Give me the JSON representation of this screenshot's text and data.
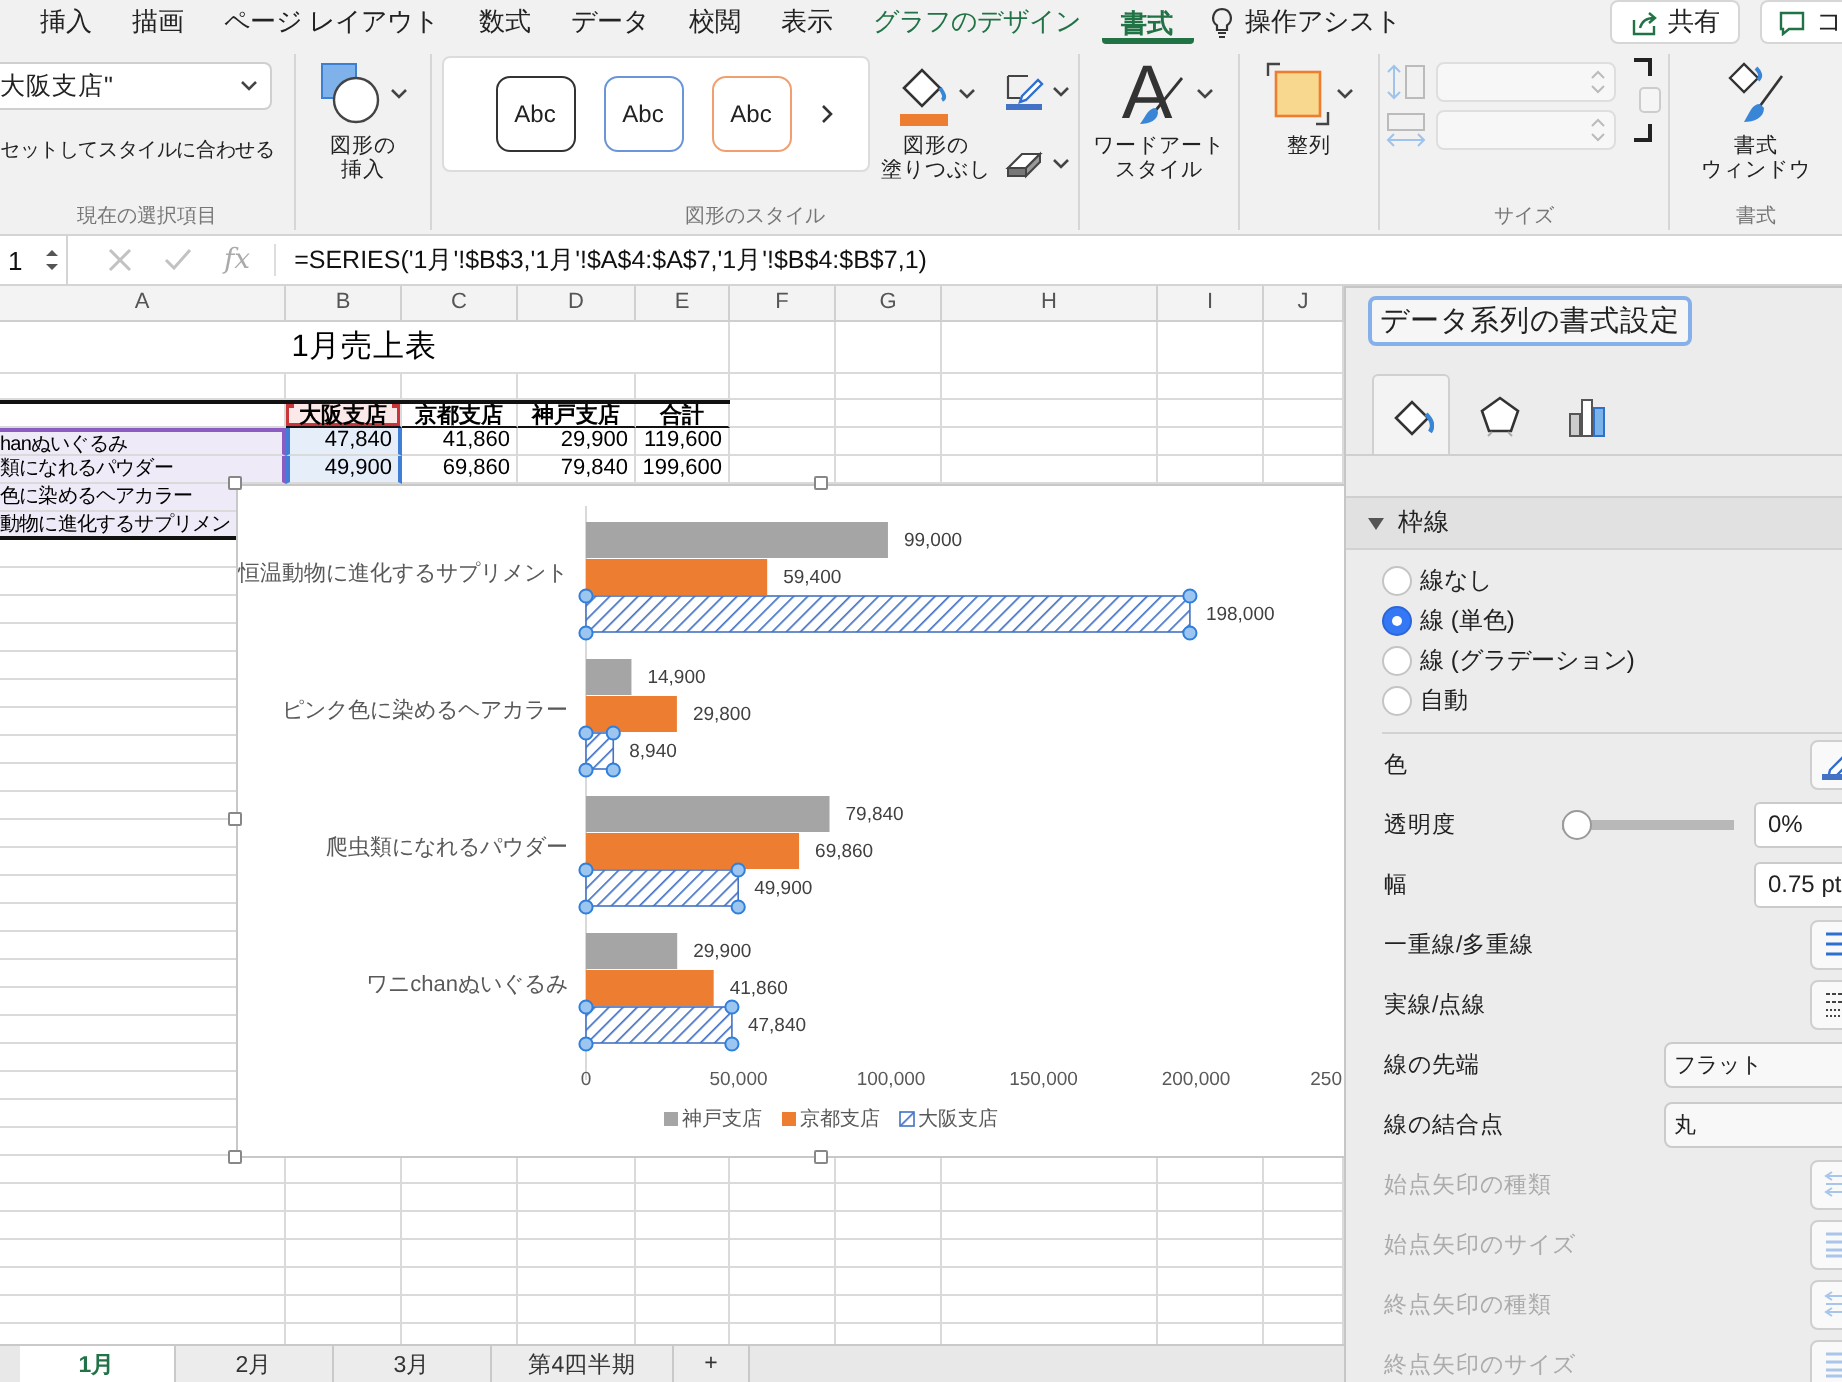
{
  "ribbon": {
    "tabs": [
      {
        "label": "挿入",
        "kind": "standard",
        "selected": false
      },
      {
        "label": "描画",
        "kind": "standard",
        "selected": false
      },
      {
        "label": "ページ レイアウト",
        "kind": "standard",
        "selected": false
      },
      {
        "label": "数式",
        "kind": "standard",
        "selected": false
      },
      {
        "label": "データ",
        "kind": "standard",
        "selected": false
      },
      {
        "label": "校閲",
        "kind": "standard",
        "selected": false
      },
      {
        "label": "表示",
        "kind": "standard",
        "selected": false
      },
      {
        "label": "グラフのデザイン",
        "kind": "contextual",
        "selected": false
      },
      {
        "label": "書式",
        "kind": "contextual",
        "selected": true
      }
    ],
    "tell_me": "操作アシスト",
    "share_button": "共有",
    "comments_button": "コ",
    "current_selection": {
      "dropdown": "大阪支店\"",
      "format_button": "セットしてスタイルに合わせる",
      "label": "現在の選択項目"
    },
    "insert_shape_button": [
      "図形の",
      "挿入"
    ],
    "shape_styles": {
      "presets": [
        {
          "text": "Abc",
          "color": "#333333"
        },
        {
          "text": "Abc",
          "color": "#6a95d8"
        },
        {
          "text": "Abc",
          "color": "#f0a070"
        }
      ],
      "fill_button": [
        "図形の",
        "塗りつぶし"
      ],
      "label": "図形のスタイル"
    },
    "wordart_glyph": "A",
    "wordart_button": [
      "ワードアート",
      "スタイル"
    ],
    "arrange_button": "整列",
    "size": {
      "label": "サイズ",
      "disabled": true
    },
    "format_pane_button": [
      "書式",
      "ウィンドウ"
    ],
    "format_label": "書式"
  },
  "formula_bar": {
    "name_box": "1",
    "fx": "fx",
    "formula": "=SERIES('1月'!$B$3,'1月'!$A$4:$A$7,'1月'!$B$4:$B$7,1)"
  },
  "sheet": {
    "columns": [
      "A",
      "B",
      "C",
      "D",
      "E",
      "F",
      "G",
      "H",
      "I",
      "J"
    ],
    "title": "1月売上表",
    "header": [
      {
        "text": "大阪支店",
        "highlighted": true
      },
      {
        "text": "京都支店",
        "highlighted": false
      },
      {
        "text": "神戸支店",
        "highlighted": false
      },
      {
        "text": "合計",
        "highlighted": false
      }
    ],
    "rows": [
      {
        "name": "hanぬいぐるみ",
        "name_highlighted": true,
        "values": [
          {
            "text": "47,840",
            "highlighted": true
          },
          {
            "text": "41,860",
            "highlighted": false
          },
          {
            "text": "29,900",
            "highlighted": false
          },
          {
            "text": "119,600",
            "highlighted": false
          }
        ]
      },
      {
        "name": "類になれるパウダー",
        "name_highlighted": true,
        "values": [
          {
            "text": "49,900",
            "highlighted": true
          },
          {
            "text": "69,860",
            "highlighted": false
          },
          {
            "text": "79,840",
            "highlighted": false
          },
          {
            "text": "199,600",
            "highlighted": false
          }
        ]
      },
      {
        "name": "色に染めるヘアカラー",
        "name_highlighted": true
      },
      {
        "name": "動物に進化するサプリメン",
        "name_highlighted": true
      }
    ]
  },
  "chart": {
    "selected": true,
    "cut_tick_label": "250",
    "series_styles": [
      {
        "hatched": false,
        "selected": false
      },
      {
        "hatched": false,
        "selected": false
      },
      {
        "hatched": true,
        "selected": true
      }
    ],
    "chart_data": {
      "type": "bar",
      "orientation": "horizontal",
      "legend": "bottom",
      "categories": [
        "恒温動物に進化するサプリメント",
        "ピンク色に染めるヘアカラー",
        "爬虫類になれるパウダー",
        "ワニchanぬいぐるみ"
      ],
      "series": [
        {
          "name": "神戸支店",
          "color": "#a5a5a5",
          "values": [
            99000,
            14900,
            79840,
            29900
          ],
          "value_labels": [
            "99,000",
            "14,900",
            "79,840",
            "29,900"
          ]
        },
        {
          "name": "京都支店",
          "color": "#ed7d31",
          "values": [
            59400,
            29800,
            69860,
            41860
          ],
          "value_labels": [
            "59,400",
            "29,800",
            "69,860",
            "41,860"
          ]
        },
        {
          "name": "大阪支店",
          "color": "#4472c4",
          "values": [
            198000,
            8940,
            49900,
            47840
          ],
          "value_labels": [
            "198,000",
            "8,940",
            "49,900",
            "47,840"
          ]
        }
      ],
      "xlim": [
        0,
        250000
      ],
      "xticks": [
        {
          "value": 0,
          "label": "0"
        },
        {
          "value": 50000,
          "label": "50,000"
        },
        {
          "value": 100000,
          "label": "100,000"
        },
        {
          "value": 150000,
          "label": "150,000"
        },
        {
          "value": 200000,
          "label": "200,000"
        }
      ]
    }
  },
  "format_pane": {
    "title": "データ系列の書式設定",
    "tabs": [
      {
        "kind": "fill_line",
        "selected": true
      },
      {
        "kind": "effects",
        "selected": false
      },
      {
        "kind": "series_options",
        "selected": false
      }
    ],
    "section": {
      "title": "枠線",
      "expanded": true
    },
    "line_options": [
      {
        "label": "線なし",
        "selected": false
      },
      {
        "label": "線 (単色)",
        "selected": true
      },
      {
        "label": "線 (グラデーション)",
        "selected": false
      },
      {
        "label": "自動",
        "selected": false
      }
    ],
    "properties": [
      {
        "kind": "color",
        "label": "色",
        "disabled": false
      },
      {
        "kind": "slider",
        "label": "透明度",
        "level": 0,
        "value": "0%",
        "disabled": false
      },
      {
        "kind": "input",
        "label": "幅",
        "value": "0.75 pt",
        "disabled": false
      },
      {
        "kind": "compound",
        "label": "一重線/多重線",
        "disabled": false
      },
      {
        "kind": "dash",
        "label": "実線/点線",
        "disabled": false
      },
      {
        "kind": "dropdown",
        "label": "線の先端",
        "value": "フラット",
        "disabled": false
      },
      {
        "kind": "dropdown",
        "label": "線の結合点",
        "value": "丸",
        "disabled": false
      },
      {
        "kind": "arrow_type",
        "label": "始点矢印の種類",
        "disabled": true
      },
      {
        "kind": "arrow_size",
        "label": "始点矢印のサイズ",
        "disabled": true
      },
      {
        "kind": "arrow_type",
        "label": "終点矢印の種類",
        "disabled": true
      },
      {
        "kind": "arrow_size",
        "label": "終点矢印のサイズ",
        "disabled": true
      }
    ]
  },
  "sheet_tabs": [
    {
      "label": "1月",
      "selected": true
    },
    {
      "label": "2月",
      "selected": false
    },
    {
      "label": "3月",
      "selected": false
    },
    {
      "label": "第4四半期",
      "selected": false
    }
  ],
  "add_sheet_button": "+"
}
